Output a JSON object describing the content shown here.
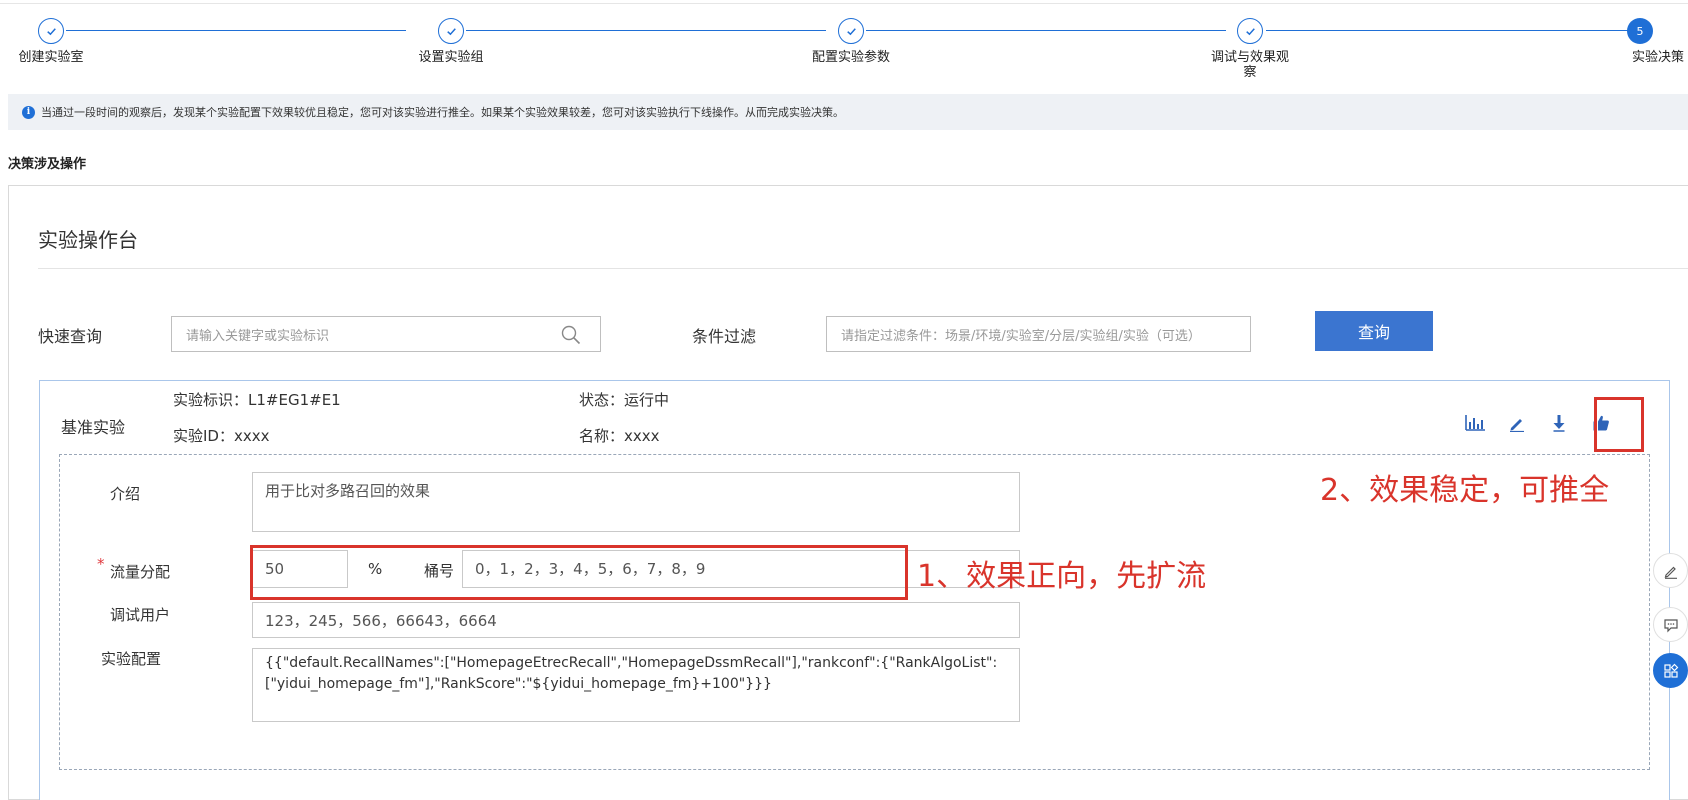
{
  "steps": [
    {
      "label": "创建实验室",
      "status": "done"
    },
    {
      "label": "设置实验组",
      "status": "done"
    },
    {
      "label": "配置实验参数",
      "status": "done"
    },
    {
      "label": "调试与效果观察",
      "status": "done"
    },
    {
      "label": "实验决策",
      "status": "active",
      "number": "5"
    }
  ],
  "info_text": "当通过一段时间的观察后，发现某个实验配置下效果较优且稳定，您可对该实验进行推全。如果某个实验效果较差，您可对该实验执行下线操作。从而完成实验决策。",
  "section_title": "决策涉及操作",
  "console": {
    "title": "实验操作台",
    "quick_query_label": "快速查询",
    "quick_query_placeholder": "请输入关键字或实验标识",
    "filter_label": "条件过滤",
    "filter_placeholder": "请指定过滤条件：场景/环境/实验室/分层/实验组/实验（可选）",
    "query_button": "查询"
  },
  "experiment": {
    "type_label": "基准实验",
    "id_tag_label": "实验标识：",
    "id_tag_value": "L1#EG1#E1",
    "id_label": "实验ID：",
    "id_value": "xxxx",
    "status_label": "状态：",
    "status_value": "运行中",
    "name_label": "名称：",
    "name_value": "xxxx",
    "toolbar_icons": [
      "bar-chart-icon",
      "edit-icon",
      "download-icon",
      "thumbs-up-icon"
    ],
    "fields": {
      "intro_label": "介绍",
      "intro_value": "用于比对多路召回的效果",
      "traffic_label": "流量分配",
      "traffic_percent_value": "50",
      "percent_sign": "%",
      "bucket_label": "桶号",
      "bucket_value": "0，1，2，3，4，5，6，7，8，9",
      "debug_users_label": "调试用户",
      "debug_users_value": "123，245，566，66643，6664",
      "config_label": "实验配置",
      "config_value": "{{\"default.RecallNames\":[\"HomepageEtrecRecall\",\"HomepageDssmRecall\"],\"rankconf\":{\"RankAlgoList\":[\"yidui_homepage_fm\"],\"RankScore\":\"${yidui_homepage_fm}+100\"}}}"
    }
  },
  "annotations": {
    "one": "1、效果正向，先扩流",
    "two": "2、效果稳定，可推全"
  },
  "colors": {
    "accent": "#1f6fd6",
    "button": "#3b75d0",
    "annotation": "#d9342b"
  }
}
